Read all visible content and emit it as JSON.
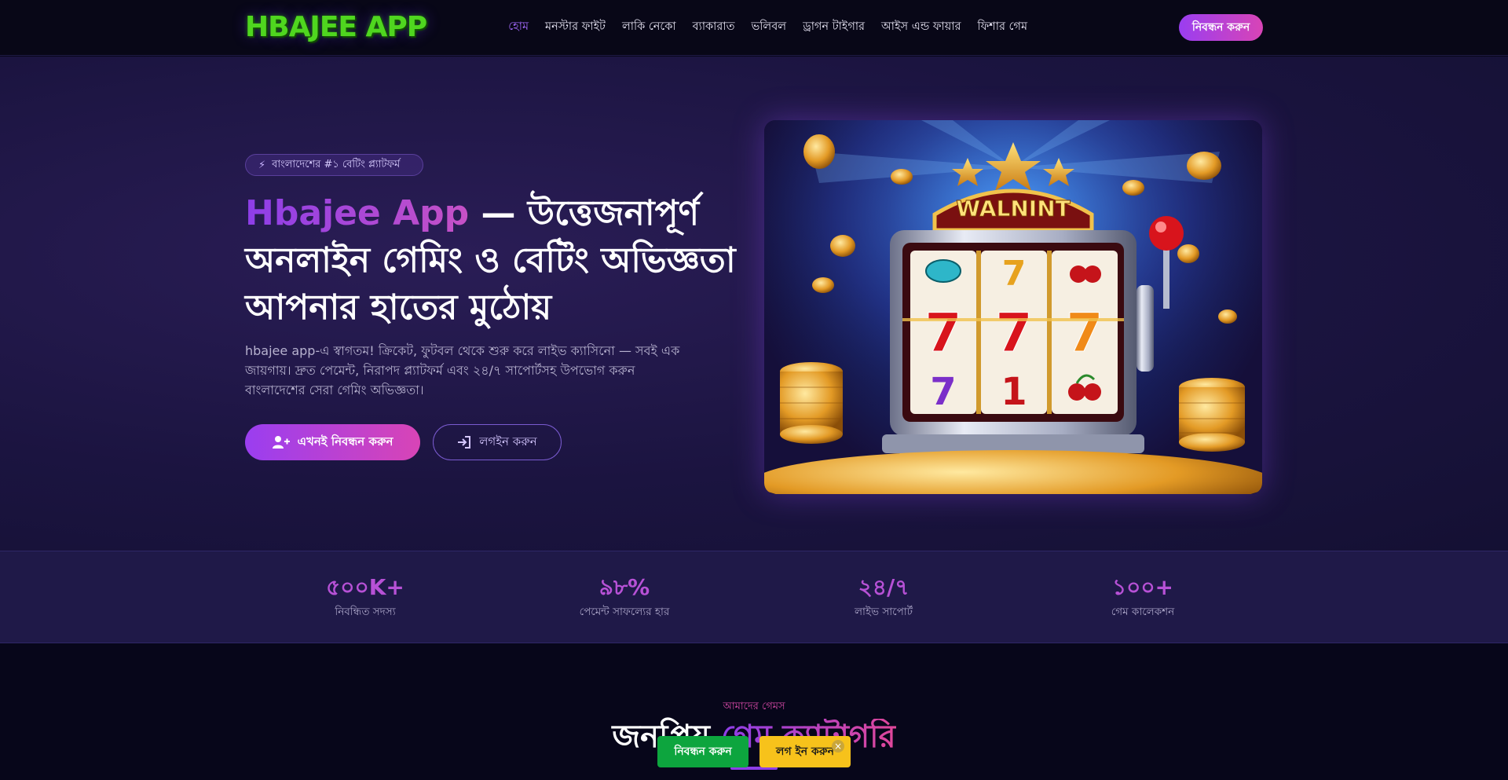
{
  "nav": {
    "logo": "HBAJEE APP",
    "links": [
      "হোম",
      "মনস্টার ফাইট",
      "লাকি নেকো",
      "ব্যাকারাত",
      "ভলিবল",
      "ড্রাগন টাইগার",
      "আইস এন্ড ফায়ার",
      "ফিশার গেম"
    ],
    "cta": "নিবন্ধন করুন"
  },
  "hero": {
    "badge": "বাংলাদেশের #১ বেটিং প্ল্যাটফর্ম",
    "title_accent": "Hbajee App",
    "title_rest": " — উত্তেজনাপূর্ণ অনলাইন গেমিং ও বেটিং অভিজ্ঞতা আপনার হাতের মুঠোয়",
    "description": "hbajee app-এ স্বাগতম! ক্রিকেট, ফুটবল থেকে শুরু করে লাইভ ক্যাসিনো — সবই এক জায়গায়। দ্রুত পেমেন্ট, নিরাপদ প্ল্যাটফর্ম এবং ২৪/৭ সাপোর্টসহ উপভোগ করুন বাংলাদেশের সেরা গেমিং অভিজ্ঞতা।",
    "primary_button": "এখনই নিবন্ধন করুন",
    "secondary_button": "লগইন করুন",
    "machine_sign": "WALNINT",
    "reels": [
      [
        "7",
        "7",
        "7"
      ],
      [
        "7",
        "1",
        "🍒"
      ]
    ]
  },
  "stats": [
    {
      "value": "৫০০K+",
      "label": "নিবন্ধিত সদস্য"
    },
    {
      "value": "৯৮%",
      "label": "পেমেন্ট সাফল্যের হার"
    },
    {
      "value": "২৪/৭",
      "label": "লাইভ সাপোর্ট"
    },
    {
      "value": "১০০+",
      "label": "গেম কালেকশন"
    }
  ],
  "games": {
    "eyebrow": "আমাদের গেমস",
    "title_plain": "জনপ্রিয় ",
    "title_accent": "গেম ক্যাটাগরি"
  },
  "sticky": {
    "register": "নিবন্ধন করুন",
    "login": "লগ ইন করুন",
    "close": "×"
  },
  "colors": {
    "accent_purple": "#9a3ef0",
    "accent_pink": "#d844b6",
    "register_green": "#0da53e",
    "login_yellow": "#f7c21b"
  }
}
